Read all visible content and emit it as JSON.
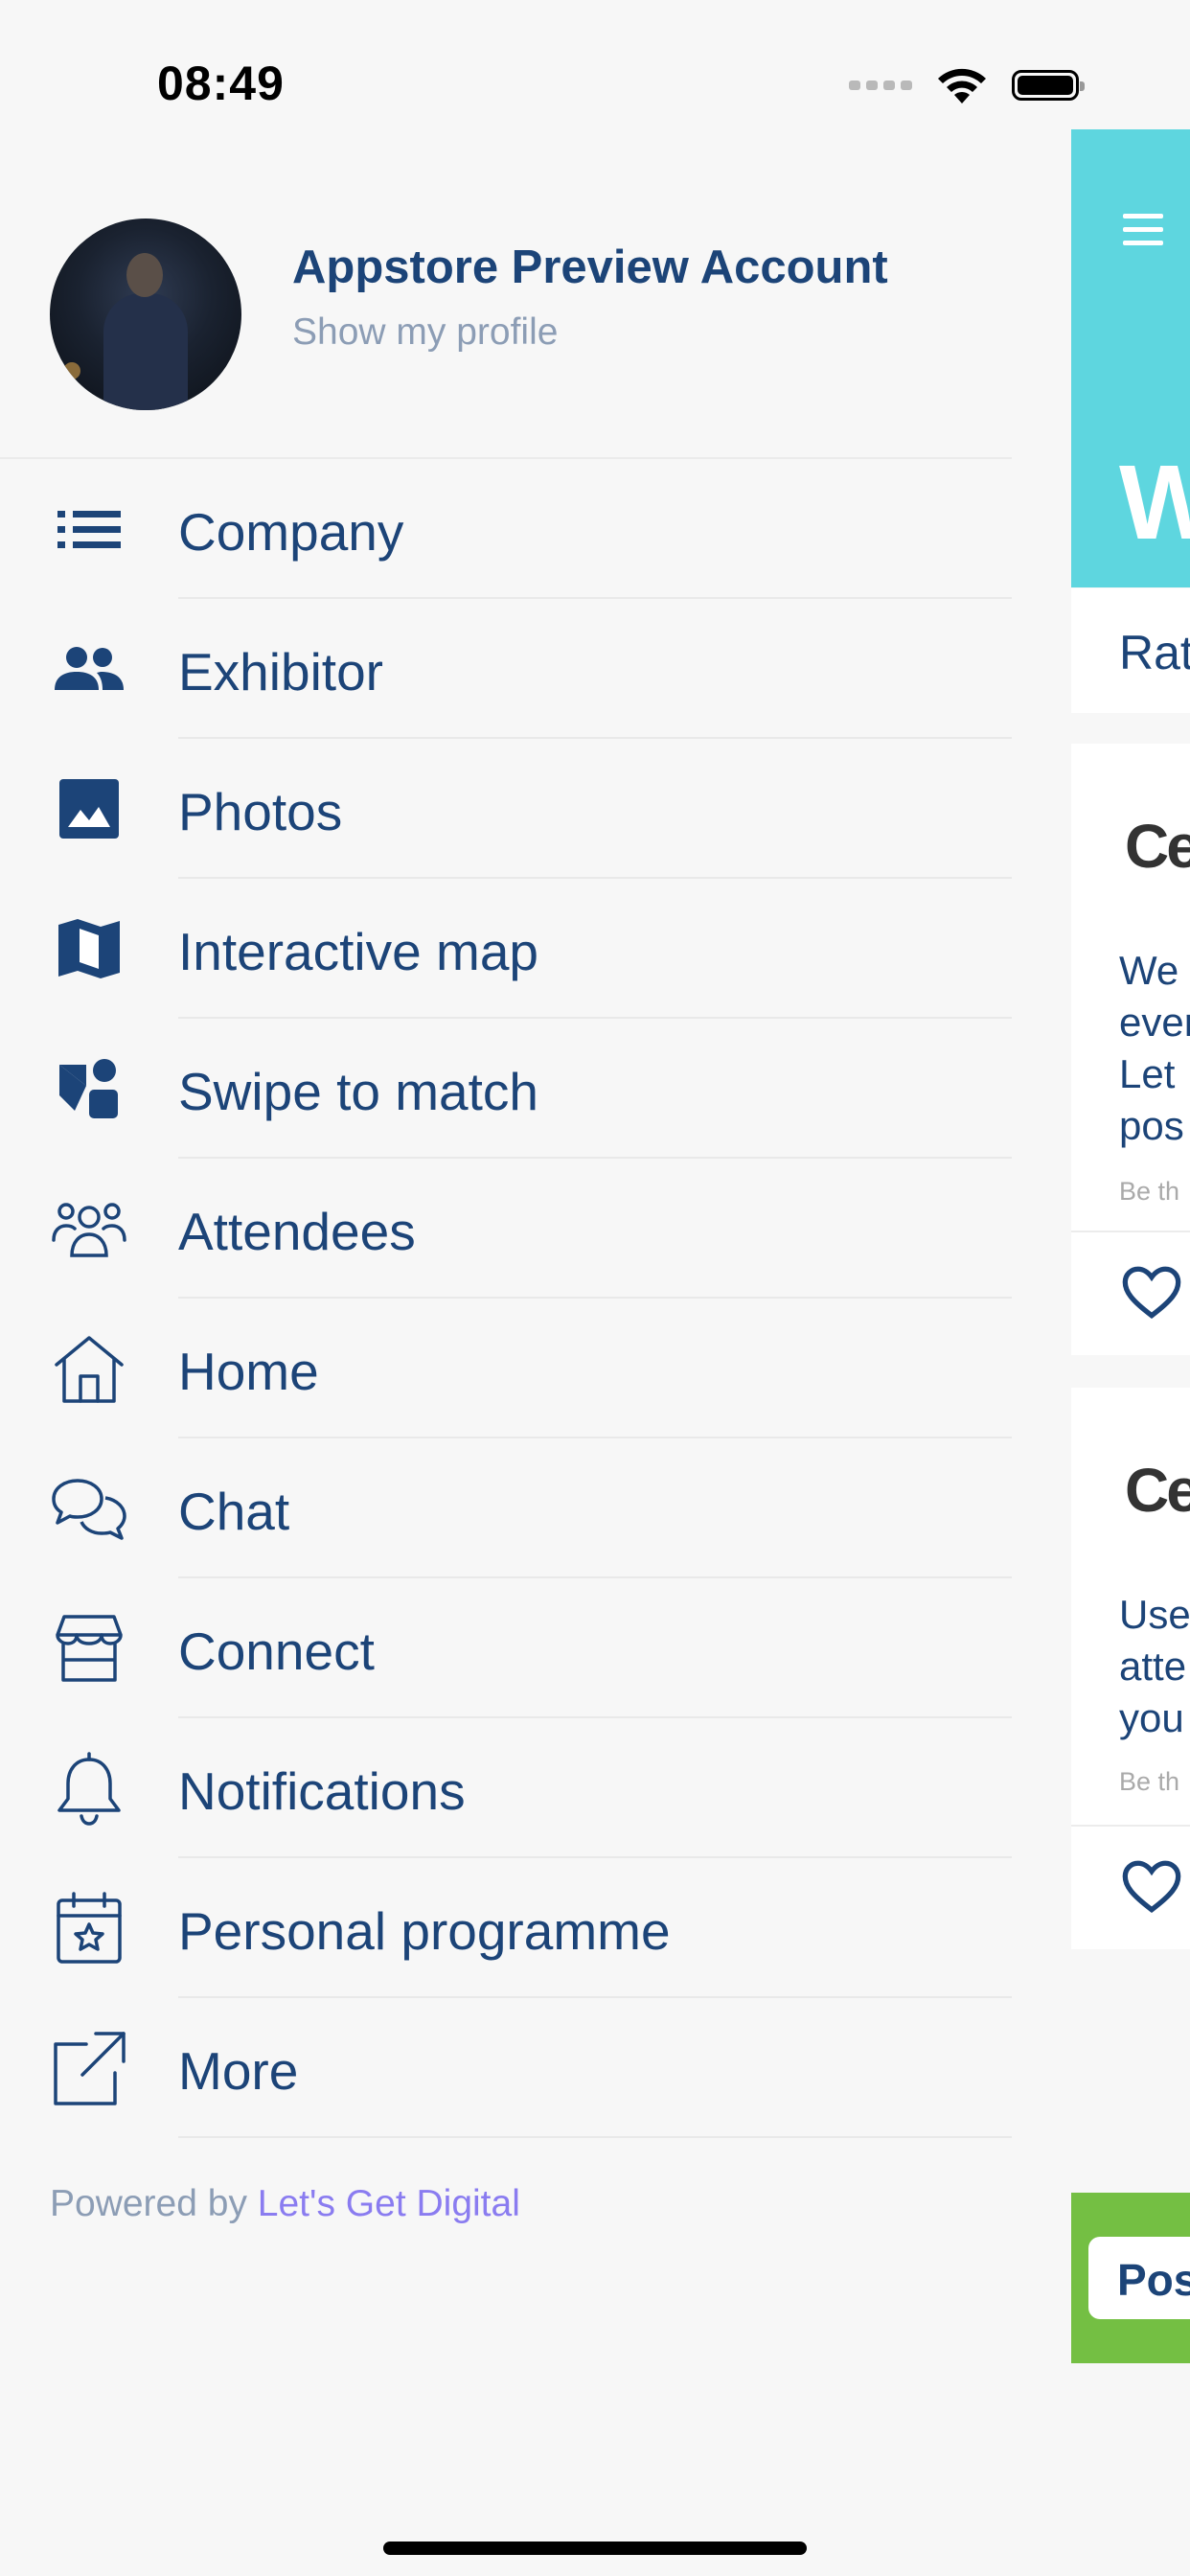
{
  "status_bar": {
    "time": "08:49"
  },
  "profile": {
    "name": "Appstore Preview Account",
    "subtitle": "Show my profile"
  },
  "menu": {
    "items": [
      {
        "label": "Company",
        "icon": "list-icon"
      },
      {
        "label": "Exhibitor",
        "icon": "people-icon"
      },
      {
        "label": "Photos",
        "icon": "image-icon"
      },
      {
        "label": "Interactive map",
        "icon": "map-icon"
      },
      {
        "label": "Swipe to match",
        "icon": "shapes-icon"
      },
      {
        "label": "Attendees",
        "icon": "attendees-icon"
      },
      {
        "label": "Home",
        "icon": "home-icon"
      },
      {
        "label": "Chat",
        "icon": "chat-icon"
      },
      {
        "label": "Connect",
        "icon": "storefront-icon"
      },
      {
        "label": "Notifications",
        "icon": "bell-icon"
      },
      {
        "label": "Personal programme",
        "icon": "calendar-star-icon"
      },
      {
        "label": "More",
        "icon": "external-link-icon"
      }
    ]
  },
  "footer": {
    "powered_prefix": "Powered by",
    "powered_link": "Let's Get Digital"
  },
  "background_peek": {
    "header_fragment": "W",
    "rating_fragment": "Rat",
    "card1": {
      "logo_fragment": "Ce",
      "lines": [
        "We",
        "ever",
        "Let",
        "pos"
      ],
      "meta": "Be th"
    },
    "card2": {
      "logo_fragment": "Ce",
      "lines": [
        "Use",
        "atte",
        "you"
      ],
      "meta": "Be th"
    },
    "post_button_fragment": "Pos"
  },
  "colors": {
    "primary": "#1c4478",
    "accent_teal": "#5ed6df",
    "accent_green": "#74bf43",
    "link": "#8a7cf0"
  }
}
